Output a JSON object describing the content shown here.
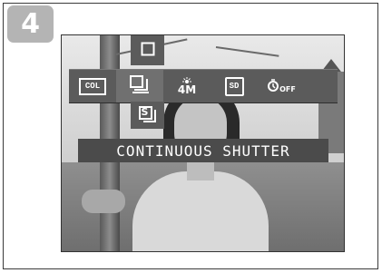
{
  "step": {
    "number": "4"
  },
  "menu": {
    "top_option_icon": "single-frame-icon",
    "bar": [
      {
        "id": "color",
        "icon": "color-mode-icon",
        "text": "COL"
      },
      {
        "id": "drive",
        "icon": "continuous-shutter-icon",
        "text": "",
        "active": true
      },
      {
        "id": "resolution",
        "icon": "resolution-4m-icon",
        "text": "4M"
      },
      {
        "id": "storage",
        "icon": "sd-card-icon",
        "text": "SD"
      },
      {
        "id": "self-timer",
        "icon": "self-timer-off-icon",
        "text": "OFF"
      }
    ],
    "bottom_option_icon": "sequence-s-icon",
    "bottom_option_text": "S"
  },
  "status": {
    "label": "CONTINUOUS SHUTTER"
  },
  "colors": {
    "menu_bg": "#5b5b5b",
    "label_bg": "#4b4b4b",
    "badge_bg": "#b4b4b4"
  }
}
